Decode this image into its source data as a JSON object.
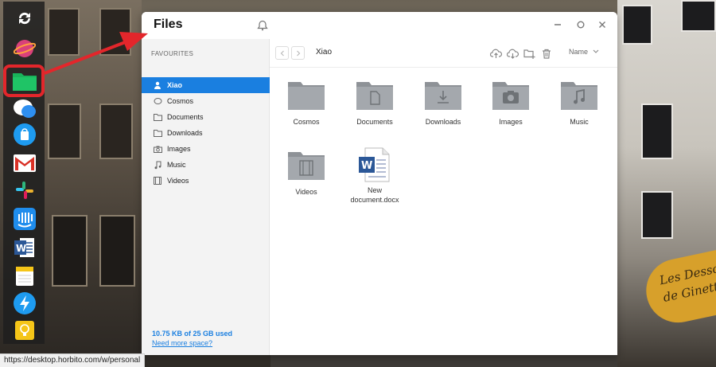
{
  "window": {
    "title": "Files"
  },
  "sidebar": {
    "heading": "FAVOURITES",
    "items": [
      {
        "label": "Xiao",
        "icon": "user-icon",
        "active": true
      },
      {
        "label": "Cosmos",
        "icon": "cosmos-icon",
        "active": false
      },
      {
        "label": "Documents",
        "icon": "folder-icon",
        "active": false
      },
      {
        "label": "Downloads",
        "icon": "folder-icon",
        "active": false
      },
      {
        "label": "Images",
        "icon": "camera-icon",
        "active": false
      },
      {
        "label": "Music",
        "icon": "music-note-icon",
        "active": false
      },
      {
        "label": "Videos",
        "icon": "film-icon",
        "active": false
      }
    ],
    "storage_used": "10.75 KB of 25 GB used",
    "storage_more": "Need more space?"
  },
  "toolbar": {
    "breadcrumb": "Xiao",
    "sort_label": "Name"
  },
  "files": [
    {
      "label": "Cosmos",
      "type": "folder",
      "emblem": "none"
    },
    {
      "label": "Documents",
      "type": "folder",
      "emblem": "document"
    },
    {
      "label": "Downloads",
      "type": "folder",
      "emblem": "download"
    },
    {
      "label": "Images",
      "type": "folder",
      "emblem": "camera"
    },
    {
      "label": "Music",
      "type": "folder",
      "emblem": "music"
    },
    {
      "label": "Videos",
      "type": "folder",
      "emblem": "film"
    },
    {
      "label_line1": "New",
      "label_line2": "document.docx",
      "type": "word-document"
    }
  ],
  "status_url": "https://desktop.horbito.com/w/personal",
  "dock": {
    "apps": [
      "sync-icon",
      "cosmos-planet-icon",
      "files-folder-icon",
      "chat-bubble-icon",
      "shopping-bag-icon",
      "gmail-icon",
      "slack-icon",
      "intercom-icon",
      "word-icon",
      "notes-icon",
      "bolt-icon",
      "idea-bulb-icon"
    ]
  },
  "sign_text": [
    "Les Desso",
    "de Ginett"
  ],
  "colors": {
    "accent": "#1a7fe0",
    "highlight_red": "#e3262b",
    "folder_gray": "#9a9ea3"
  }
}
